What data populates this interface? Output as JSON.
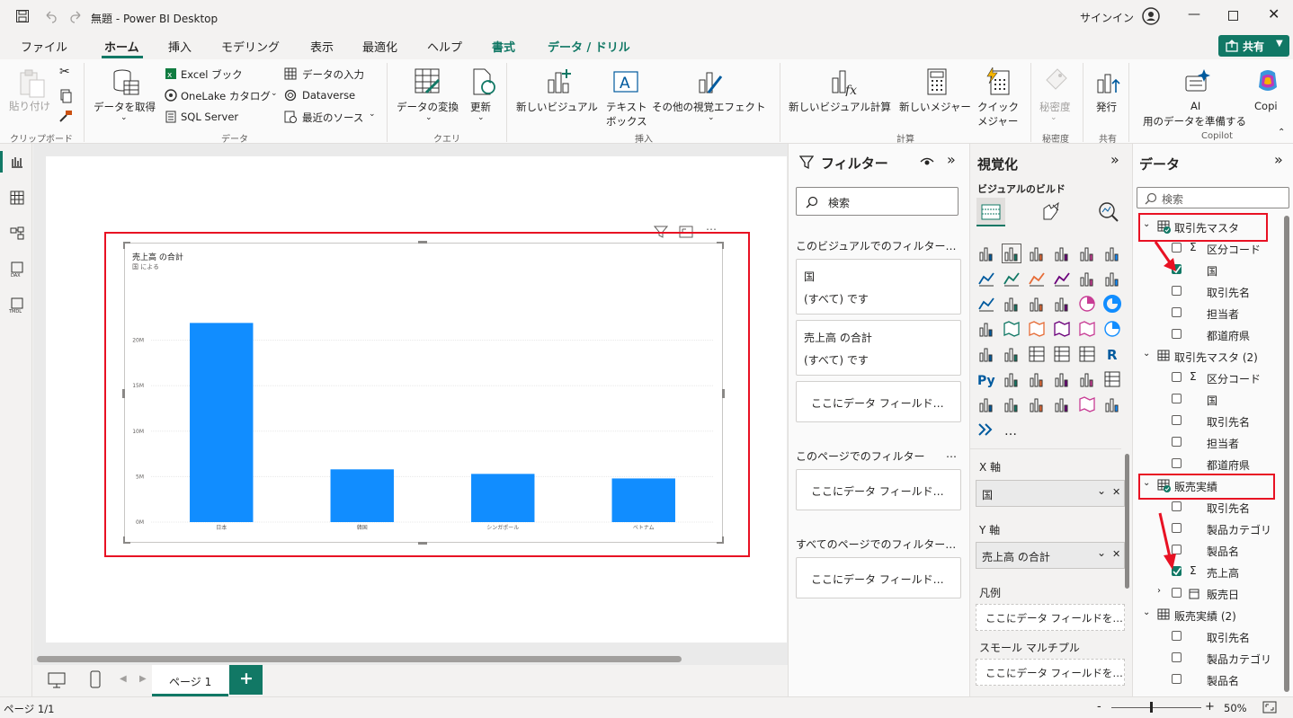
{
  "titlebar": {
    "title": "無題 - Power BI Desktop",
    "signin": "サインイン"
  },
  "menu": {
    "tabs": [
      "ファイル",
      "ホーム",
      "挿入",
      "モデリング",
      "表示",
      "最適化",
      "ヘルプ",
      "書式",
      "データ / ドリル"
    ],
    "share": "共有"
  },
  "ribbon": {
    "paste": "貼り付け",
    "clipboard": "クリップボード",
    "get_data": "データを取得",
    "excel": "Excel ブック",
    "onelake": "OneLake カタログ",
    "sql": "SQL Server",
    "enter_data": "データの入力",
    "dataverse": "Dataverse",
    "recent": "最近のソース",
    "data_group": "データ",
    "transform": "データの変換",
    "refresh": "更新",
    "query_group": "クエリ",
    "new_visual": "新しいビジュアル",
    "textbox_1": "テキスト",
    "textbox_2": "ボックス",
    "more_visuals": "その他の視覚エフェクト",
    "insert_group": "挿入",
    "new_visual_calc": "新しいビジュアル計算",
    "new_measure": "新しいメジャー",
    "quick_measure_1": "クイック",
    "quick_measure_2": "メジャー",
    "calc_group": "計算",
    "sensitivity": "秘密度",
    "sensitivity_group": "秘密度",
    "publish": "発行",
    "share_group": "共有",
    "ai_1": "AI",
    "ai_2": "用のデータを準備する",
    "copilot": "Copi",
    "copilot_group": "Copilot"
  },
  "chart_data": {
    "type": "bar",
    "title": "売上高 の合計",
    "subtitle": "国 による",
    "categories": [
      "日本",
      "韓国",
      "シンガポール",
      "ベトナム"
    ],
    "values": [
      21900000,
      5800000,
      5300000,
      4800000
    ],
    "ylim": [
      0,
      25000000
    ],
    "ytick_values": [
      0,
      5000000,
      10000000,
      15000000,
      20000000
    ],
    "ytick_labels": [
      "0M",
      "5M",
      "10M",
      "15M",
      "20M"
    ],
    "bar_color": "#118dff",
    "grid": true
  },
  "filters": {
    "title": "フィルター",
    "search": "検索",
    "visual_section": "このビジュアルでのフィルター…",
    "card1_title": "国",
    "card1_value": "(すべて) です",
    "card2_title": "売上高 の合計",
    "card2_value": "(すべて) です",
    "drop_here": "ここにデータ フィールド…",
    "page_section": "このページでのフィルター",
    "page_more": "…",
    "all_section": "すべてのページでのフィルター…"
  },
  "viz": {
    "title": "視覚化",
    "build": "ビジュアルのビルド",
    "x_axis": "X 軸",
    "x_field": "国",
    "y_axis": "Y 軸",
    "y_field": "売上高 の合計",
    "legend": "凡例",
    "legend_drop": "ここにデータ フィールドを…",
    "small_multiples": "スモール マルチプル",
    "sm_drop": "ここにデータ フィールドを…",
    "more": "…"
  },
  "data": {
    "title": "データ",
    "search": "検索",
    "tables": [
      {
        "name": "取引先マスタ",
        "fields": [
          {
            "label": "区分コード",
            "sigma": true,
            "checked": false
          },
          {
            "label": "国",
            "sigma": false,
            "checked": true
          },
          {
            "label": "取引先名",
            "sigma": false,
            "checked": false
          },
          {
            "label": "担当者",
            "sigma": false,
            "checked": false
          },
          {
            "label": "都道府県",
            "sigma": false,
            "checked": false
          }
        ]
      },
      {
        "name": "取引先マスタ (2)",
        "fields": [
          {
            "label": "区分コード",
            "sigma": true,
            "checked": false
          },
          {
            "label": "国",
            "sigma": false,
            "checked": false
          },
          {
            "label": "取引先名",
            "sigma": false,
            "checked": false
          },
          {
            "label": "担当者",
            "sigma": false,
            "checked": false
          },
          {
            "label": "都道府県",
            "sigma": false,
            "checked": false
          }
        ]
      },
      {
        "name": "販売実績",
        "fields": [
          {
            "label": "取引先名",
            "sigma": false,
            "checked": false
          },
          {
            "label": "製品カテゴリ",
            "sigma": false,
            "checked": false
          },
          {
            "label": "製品名",
            "sigma": false,
            "checked": false
          },
          {
            "label": "売上高",
            "sigma": true,
            "checked": true
          },
          {
            "label": "販売日",
            "sigma": false,
            "checked": false
          }
        ]
      },
      {
        "name": "販売実績 (2)",
        "fields": [
          {
            "label": "取引先名",
            "sigma": false,
            "checked": false
          },
          {
            "label": "製品カテゴリ",
            "sigma": false,
            "checked": false
          },
          {
            "label": "製品名",
            "sigma": false,
            "checked": false
          }
        ]
      }
    ]
  },
  "pages": {
    "tab": "ページ 1",
    "add": "+"
  },
  "status": {
    "page": "ページ 1/1",
    "zoom": "50%",
    "zoom_minus": "-",
    "zoom_plus": "+"
  },
  "colors": {
    "accent": "#117865",
    "bar": "#118dff",
    "highlight": "#e81123"
  }
}
